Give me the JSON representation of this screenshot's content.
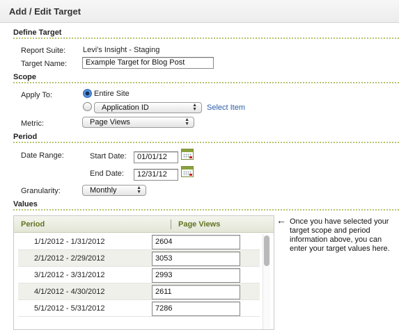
{
  "header": {
    "title": "Add / Edit Target"
  },
  "define_target": {
    "section_title": "Define Target",
    "report_suite_label": "Report Suite:",
    "report_suite_value": "Levi's Insight - Staging",
    "target_name_label": "Target Name:",
    "target_name_value": "Example Target for Blog Post"
  },
  "scope": {
    "section_title": "Scope",
    "apply_to_label": "Apply To:",
    "entire_site_label": "Entire Site",
    "entire_site_checked": true,
    "application_id_select": "Application ID",
    "select_item_link": "Select Item",
    "metric_label": "Metric:",
    "metric_select": "Page Views"
  },
  "period": {
    "section_title": "Period",
    "date_range_label": "Date Range:",
    "start_date_label": "Start Date:",
    "start_date_value": "01/01/12",
    "end_date_label": "End Date:",
    "end_date_value": "12/31/12",
    "granularity_label": "Granularity:",
    "granularity_select": "Monthly"
  },
  "values": {
    "section_title": "Values",
    "column_period": "Period",
    "column_page_views": "Page Views",
    "rows": [
      {
        "period": "1/1/2012 - 1/31/2012",
        "value": "2604"
      },
      {
        "period": "2/1/2012 - 2/29/2012",
        "value": "3053"
      },
      {
        "period": "3/1/2012 - 3/31/2012",
        "value": "2993"
      },
      {
        "period": "4/1/2012 - 4/30/2012",
        "value": "2611"
      },
      {
        "period": "5/1/2012 - 5/31/2012",
        "value": "7286"
      }
    ]
  },
  "hint": {
    "arrow_icon": "left-arrow-icon",
    "text": "Once you have selected your target scope and period information above, you can enter your target values here."
  }
}
